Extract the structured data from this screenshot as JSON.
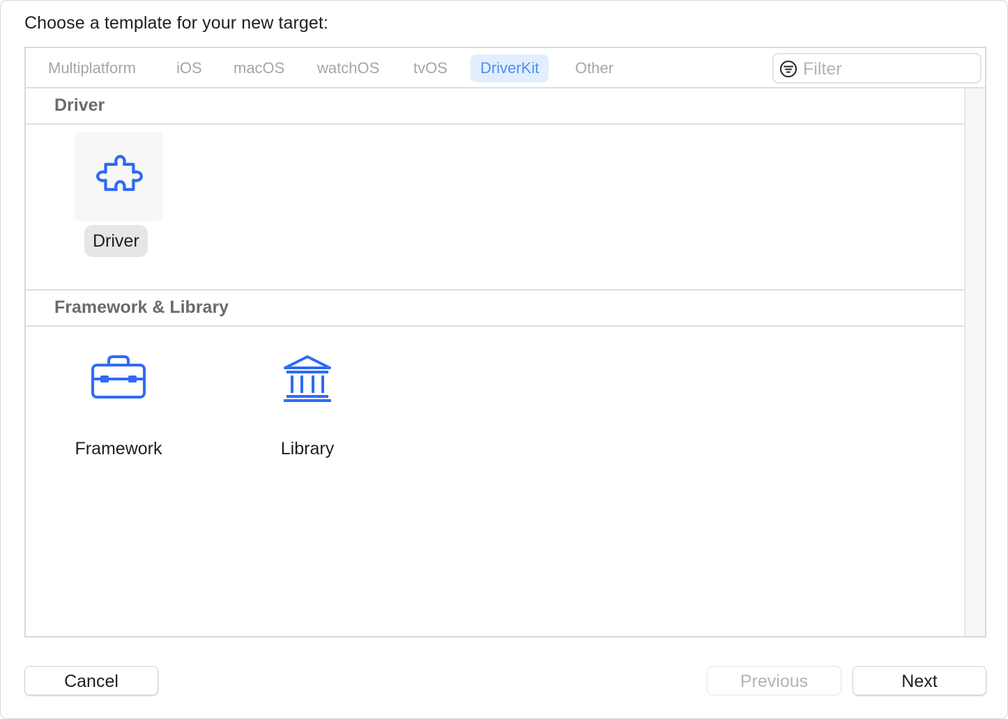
{
  "dialog": {
    "prompt": "Choose a template for your new target:"
  },
  "tabs": [
    {
      "label": "Multiplatform",
      "selected": false
    },
    {
      "label": "iOS",
      "selected": false
    },
    {
      "label": "macOS",
      "selected": false
    },
    {
      "label": "watchOS",
      "selected": false
    },
    {
      "label": "tvOS",
      "selected": false
    },
    {
      "label": "DriverKit",
      "selected": true
    },
    {
      "label": "Other",
      "selected": false
    }
  ],
  "filter": {
    "placeholder": "Filter",
    "value": "",
    "icon": "filter-icon"
  },
  "sections": [
    {
      "title": "Driver",
      "templates": [
        {
          "label": "Driver",
          "icon": "puzzle-piece-icon",
          "selected": true
        }
      ]
    },
    {
      "title": "Framework & Library",
      "templates": [
        {
          "label": "Framework",
          "icon": "toolbox-icon",
          "selected": false
        },
        {
          "label": "Library",
          "icon": "building-columns-icon",
          "selected": false
        }
      ]
    }
  ],
  "buttons": {
    "cancel": "Cancel",
    "previous": "Previous",
    "next": "Next",
    "previous_disabled": true
  },
  "colors": {
    "accent": "#2f6bf5",
    "tab_selected_bg": "#e2eefc",
    "tab_selected_text": "#4a90f2",
    "section_header_text": "#6b6b6b"
  }
}
